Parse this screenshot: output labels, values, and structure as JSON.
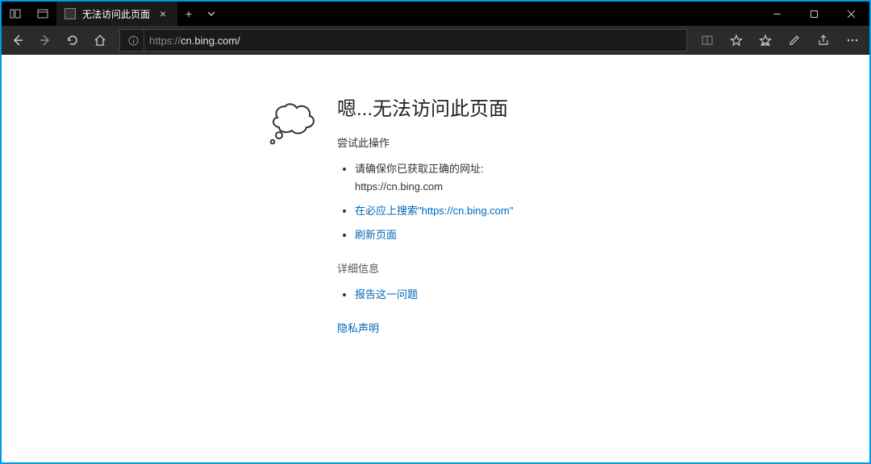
{
  "titlebar": {
    "tab_title": "无法访问此页面"
  },
  "toolbar": {
    "url_protocol": "https://",
    "url_rest": "cn.bing.com/"
  },
  "error": {
    "heading": "嗯...无法访问此页面",
    "try_label": "尝试此操作",
    "ensure_text": "请确保你已获取正确的网址:",
    "ensure_url": "https://cn.bing.com",
    "search_link": "在必应上搜索\"https://cn.bing.com\"",
    "refresh_link": "刷新页面",
    "details_label": "详细信息",
    "report_link": "报告这一问题",
    "privacy": "隐私声明"
  }
}
